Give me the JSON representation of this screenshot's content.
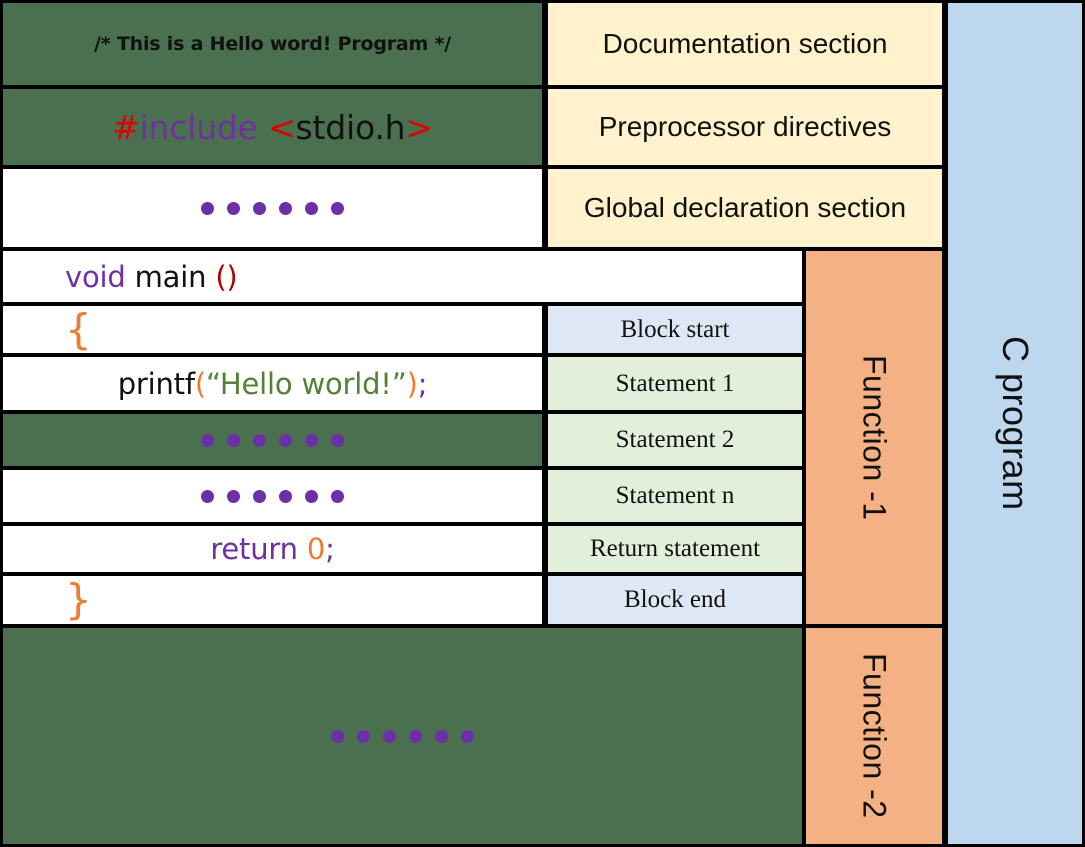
{
  "title": "C program structure diagram",
  "colors": {
    "green": "#4a7050",
    "cream": "#fff2cc",
    "blue": "#bdd7ee",
    "orange": "#f4b183",
    "statement": "#e2efda",
    "block": "#dee7f5",
    "dot_purple": "#6b2fa8",
    "keyword_purple": "#7030a0",
    "keyword_red": "#e00000",
    "keyword_orange": "#ed7d31",
    "string_green": "#548235",
    "border": "#000000"
  },
  "code": {
    "documentation": "/* This is a Hello word! Program */",
    "preprocessor": {
      "hash": "#",
      "include": "include",
      "header": "<stdio.h>"
    },
    "global_declaration_dots": "••••••",
    "main_signature": {
      "return_type": "void",
      "name": "main",
      "parens": "()"
    },
    "block_start": "{",
    "printf": {
      "fn": "printf",
      "open_paren": "(",
      "string": "“Hello world!”",
      "close_paren": ")",
      "semicolon": ";"
    },
    "statement2_dots": "••••••",
    "statementn_dots": "••••••",
    "return": {
      "keyword": "return",
      "value": "0",
      "semicolon": ";"
    },
    "block_end": "}",
    "function2_dots": "••••••"
  },
  "labels": {
    "documentation_section": "Documentation section",
    "preprocessor_directives": "Preprocessor directives",
    "global_declaration_section": "Global declaration section",
    "block_start": "Block start",
    "statement_1": "Statement 1",
    "statement_2": "Statement 2",
    "statement_n": "Statement n",
    "return_statement": "Return statement",
    "block_end": "Block end",
    "function_1": "Function -1",
    "function_2": "Function -2",
    "c_program": "C program"
  },
  "dot_count": 6
}
